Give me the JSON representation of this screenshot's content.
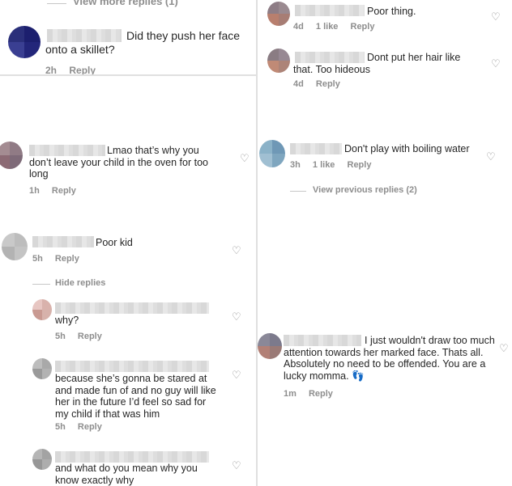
{
  "top_left": {
    "view_more": "View more replies (1)",
    "comment": "Did they push her face onto a skillet?",
    "time": "2h",
    "reply": "Reply"
  },
  "top_right": [
    {
      "text": "Poor thing.",
      "time": "4d",
      "likes": "1 like",
      "reply": "Reply"
    },
    {
      "text": "Dont put her hair like that. Too hideous",
      "time": "4d",
      "reply": "Reply"
    }
  ],
  "mid_left": {
    "text": "Lmao that’s why you don’t leave your child in the oven for too long",
    "time": "1h",
    "reply": "Reply"
  },
  "mid_right": {
    "text": "Don't play with boiling water",
    "time": "3h",
    "likes": "1 like",
    "reply": "Reply",
    "view_previous": "View previous replies (2)"
  },
  "bottom_left": {
    "parent": {
      "text": "Poor kid",
      "time": "5h",
      "reply": "Reply"
    },
    "hide_replies": "Hide replies",
    "replies": [
      {
        "text": "why?",
        "time": "5h",
        "reply": "Reply"
      },
      {
        "text": "because she’s gonna be stared at and made fun of and no guy will like her in the future I’d feel so sad for my child if that was him",
        "time": "5h",
        "reply": "Reply"
      },
      {
        "text": "and what do you mean why you know exactly why"
      }
    ]
  },
  "bottom_right": {
    "text": "I just wouldn't draw too much attention towards  her marked face. Thats all. Absolutely no need to be offended.  You are a lucky momma. 👣",
    "time": "1m",
    "reply": "Reply"
  },
  "icons": {
    "like": "heart-outline-icon",
    "avatar": "blurred-avatar"
  }
}
